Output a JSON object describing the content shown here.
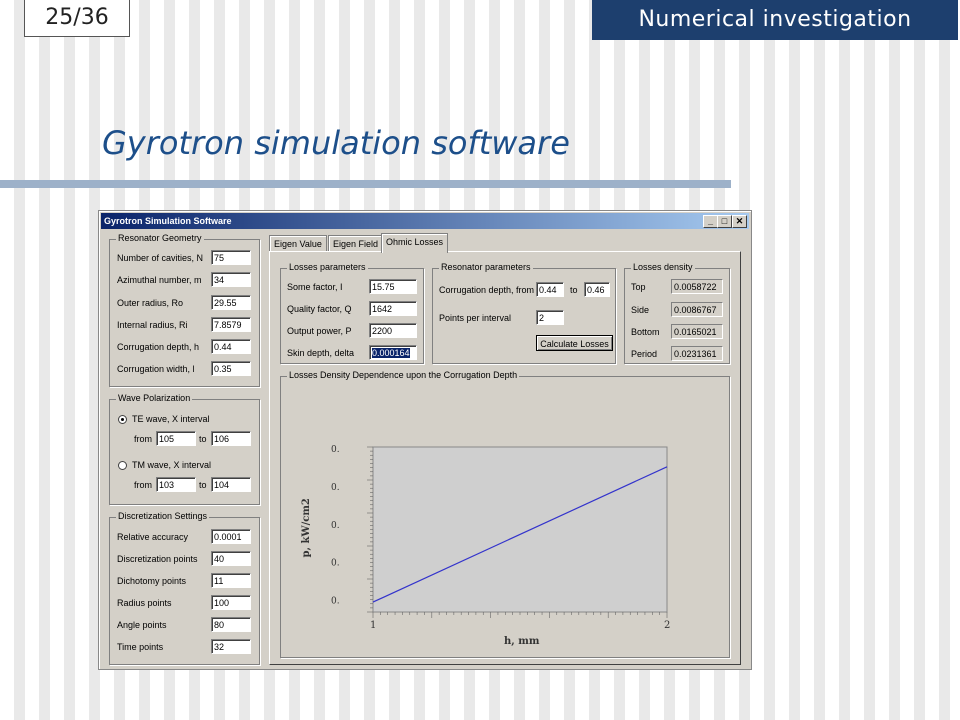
{
  "slide": {
    "page_number": "25/36",
    "section": "Numerical investigation",
    "title": "Gyrotron simulation software"
  },
  "window": {
    "title": "Gyrotron Simulation Software",
    "controls": {
      "minimize": "_",
      "maximize": "□",
      "close": "✕"
    }
  },
  "resonator_geometry": {
    "title": "Resonator Geometry",
    "fields": [
      {
        "label": "Number of cavities, N",
        "value": "75"
      },
      {
        "label": "Azimuthal number, m",
        "value": "34"
      },
      {
        "label": "Outer radius, Ro",
        "value": "29.55"
      },
      {
        "label": "Internal radius, Ri",
        "value": "7.8579"
      },
      {
        "label": "Corrugation depth, h",
        "value": "0.44"
      },
      {
        "label": "Corrugation width, l",
        "value": "0.35"
      }
    ]
  },
  "wave_polarization": {
    "title": "Wave Polarization",
    "te": {
      "label": "TE wave, X interval",
      "from_label": "from",
      "from": "105",
      "to_label": "to",
      "to": "106",
      "selected": true
    },
    "tm": {
      "label": "TM wave, X interval",
      "from_label": "from",
      "from": "103",
      "to_label": "to",
      "to": "104",
      "selected": false
    }
  },
  "discretization": {
    "title": "Discretization Settings",
    "fields": [
      {
        "label": "Relative accuracy",
        "value": "0.0001"
      },
      {
        "label": "Discretization points",
        "value": "40"
      },
      {
        "label": "Dichotomy points",
        "value": "11"
      },
      {
        "label": "Radius points",
        "value": "100"
      },
      {
        "label": "Angle points",
        "value": "80"
      },
      {
        "label": "Time points",
        "value": "32"
      }
    ]
  },
  "tabs": [
    {
      "label": "Eigen Value",
      "active": false
    },
    {
      "label": "Eigen Field",
      "active": false
    },
    {
      "label": "Ohmic Losses",
      "active": true
    }
  ],
  "losses_parameters": {
    "title": "Losses parameters",
    "fields": [
      {
        "label": "Some factor, I",
        "value": "15.75"
      },
      {
        "label": "Quality factor, Q",
        "value": "1642"
      },
      {
        "label": "Output power, P",
        "value": "2200"
      },
      {
        "label": "Skin depth, delta",
        "value": "0.000164"
      }
    ]
  },
  "resonator_parameters": {
    "title": "Resonator parameters",
    "corrugation_label": "Corrugation depth, from",
    "from": "0.44",
    "to_label": "to",
    "to": "0.46",
    "points_label": "Points per interval",
    "points": "2",
    "button": "Calculate Losses"
  },
  "losses_density": {
    "title": "Losses density",
    "rows": [
      {
        "label": "Top",
        "value": "0.0058722"
      },
      {
        "label": "Side",
        "value": "0.0086767"
      },
      {
        "label": "Bottom",
        "value": "0.0165021"
      },
      {
        "label": "Period",
        "value": "0.0231361"
      }
    ]
  },
  "chart_panel": {
    "title": "Losses Density Dependence upon the Corrugation Depth"
  },
  "chart_data": {
    "type": "line",
    "title": "",
    "xlabel": "h, mm",
    "ylabel": "p, kW/cm2",
    "x_ticks": [
      "1",
      "2"
    ],
    "y_ticks": [
      "0.",
      "0.",
      "0.",
      "0.",
      "0."
    ],
    "grid": false,
    "series": [
      {
        "x": [
          1,
          2
        ],
        "y": [
          0.06,
          0.88
        ],
        "color": "#3333cc"
      }
    ],
    "xlim": [
      1,
      2
    ],
    "ylim": [
      0,
      1
    ],
    "plot_background": "#cfcfcf"
  }
}
